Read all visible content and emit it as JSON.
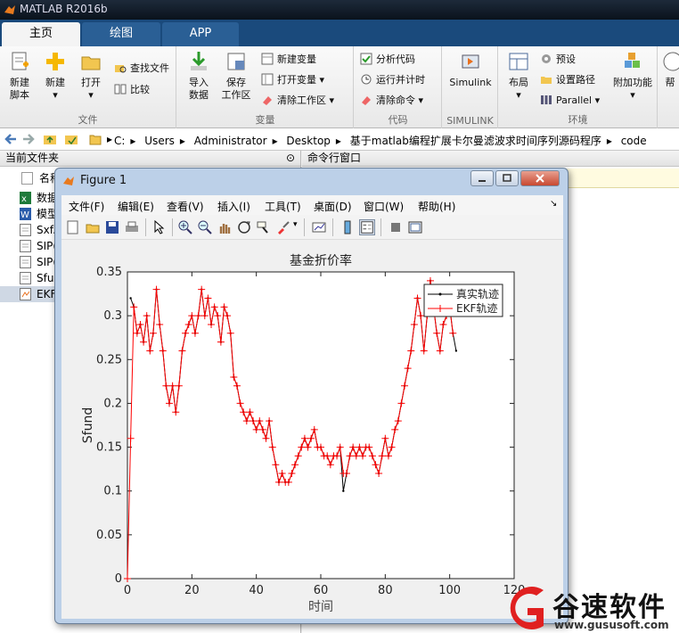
{
  "app": {
    "title": "MATLAB R2016b"
  },
  "tabs": [
    {
      "label": "主页",
      "active": true
    },
    {
      "label": "绘图",
      "active": false
    },
    {
      "label": "APP",
      "active": false
    }
  ],
  "ribbon": {
    "file": {
      "label": "文件",
      "new_script": "新建\n脚本",
      "new": "新建",
      "open": "打开",
      "find_files": "查找文件",
      "compare": "比较"
    },
    "variable": {
      "label": "变量",
      "import": "导入\n数据",
      "save_ws": "保存\n工作区",
      "new_var": "新建变量",
      "open_var": "打开变量",
      "clear_ws": "清除工作区"
    },
    "code": {
      "label": "代码",
      "analyze": "分析代码",
      "run_time": "运行并计时",
      "clear_cmd": "清除命令"
    },
    "simulink": {
      "label": "SIMULINK",
      "btn": "Simulink"
    },
    "env": {
      "label": "环境",
      "layout": "布局",
      "prefs": "预设",
      "set_path": "设置路径",
      "parallel": "Parallel",
      "addons": "附加功能",
      "help": "帮"
    }
  },
  "address": {
    "path": [
      "C:",
      "Users",
      "Administrator",
      "Desktop",
      "基于matlab编程扩展卡尔曼滤波求时间序列源码程序",
      "code"
    ]
  },
  "left_panel": {
    "title": "当前文件夹",
    "col_name": "名称",
    "files": [
      {
        "name": "数据",
        "type": "xls"
      },
      {
        "name": "模型",
        "type": "doc"
      },
      {
        "name": "Sxf.",
        "type": "m"
      },
      {
        "name": "SIP(",
        "type": "m"
      },
      {
        "name": "SIP(",
        "type": "m"
      },
      {
        "name": "Sfun",
        "type": "m"
      },
      {
        "name": "EKF",
        "type": "m",
        "selected": true
      }
    ]
  },
  "command_window": {
    "title": "命令行窗口"
  },
  "figure": {
    "title": "Figure 1",
    "menu": [
      "文件(F)",
      "编辑(E)",
      "查看(V)",
      "插入(I)",
      "工具(T)",
      "桌面(D)",
      "窗口(W)",
      "帮助(H)"
    ]
  },
  "chart_data": {
    "type": "line",
    "title": "基金折价率",
    "xlabel": "时间",
    "ylabel": "Sfund",
    "xlim": [
      0,
      120
    ],
    "ylim": [
      0,
      0.35
    ],
    "xticks": [
      "0",
      "20",
      "40",
      "60",
      "80",
      "100",
      "120"
    ],
    "yticks": [
      "0",
      "0.05",
      "0.1",
      "0.15",
      "0.2",
      "0.25",
      "0.3",
      "0.35"
    ],
    "legend_position": "top-right",
    "series": [
      {
        "name": "真实轨迹",
        "color": "#000000",
        "marker": "dot",
        "x": [
          1,
          2,
          3,
          4,
          5,
          6,
          7,
          8,
          9,
          10,
          11,
          12,
          13,
          14,
          15,
          16,
          17,
          18,
          19,
          20,
          21,
          22,
          23,
          24,
          25,
          26,
          27,
          28,
          29,
          30,
          31,
          32,
          33,
          34,
          35,
          36,
          37,
          38,
          39,
          40,
          41,
          42,
          43,
          44,
          45,
          46,
          47,
          48,
          49,
          50,
          51,
          52,
          53,
          54,
          55,
          56,
          57,
          58,
          59,
          60,
          61,
          62,
          63,
          64,
          65,
          66,
          67,
          68,
          69,
          70,
          71,
          72,
          73,
          74,
          75,
          76,
          77,
          78,
          79,
          80,
          81,
          82,
          83,
          84,
          85,
          86,
          87,
          88,
          89,
          90,
          91,
          92,
          93,
          94,
          95,
          96,
          97,
          98,
          99,
          100,
          101,
          102
        ],
        "y": [
          0.32,
          0.31,
          0.28,
          0.29,
          0.27,
          0.3,
          0.26,
          0.28,
          0.33,
          0.29,
          0.26,
          0.22,
          0.2,
          0.22,
          0.19,
          0.22,
          0.26,
          0.28,
          0.29,
          0.3,
          0.28,
          0.3,
          0.33,
          0.3,
          0.32,
          0.29,
          0.31,
          0.3,
          0.27,
          0.31,
          0.3,
          0.28,
          0.23,
          0.22,
          0.2,
          0.19,
          0.18,
          0.19,
          0.18,
          0.17,
          0.18,
          0.17,
          0.16,
          0.18,
          0.15,
          0.13,
          0.11,
          0.12,
          0.11,
          0.11,
          0.12,
          0.13,
          0.14,
          0.15,
          0.16,
          0.15,
          0.16,
          0.17,
          0.15,
          0.15,
          0.14,
          0.14,
          0.13,
          0.14,
          0.14,
          0.15,
          0.1,
          0.12,
          0.14,
          0.15,
          0.14,
          0.15,
          0.14,
          0.15,
          0.15,
          0.14,
          0.13,
          0.12,
          0.14,
          0.16,
          0.14,
          0.15,
          0.17,
          0.18,
          0.2,
          0.22,
          0.24,
          0.26,
          0.29,
          0.32,
          0.3,
          0.26,
          0.3,
          0.34,
          0.31,
          0.28,
          0.26,
          0.29,
          0.3,
          0.31,
          0.28,
          0.26
        ]
      },
      {
        "name": "EKF轨迹",
        "color": "#ff0000",
        "marker": "plus",
        "x": [
          0,
          1,
          2,
          3,
          4,
          5,
          6,
          7,
          8,
          9,
          10,
          11,
          12,
          13,
          14,
          15,
          16,
          17,
          18,
          19,
          20,
          21,
          22,
          23,
          24,
          25,
          26,
          27,
          28,
          29,
          30,
          31,
          32,
          33,
          34,
          35,
          36,
          37,
          38,
          39,
          40,
          41,
          42,
          43,
          44,
          45,
          46,
          47,
          48,
          49,
          50,
          51,
          52,
          53,
          54,
          55,
          56,
          57,
          58,
          59,
          60,
          61,
          62,
          63,
          64,
          65,
          66,
          67,
          68,
          69,
          70,
          71,
          72,
          73,
          74,
          75,
          76,
          77,
          78,
          79,
          80,
          81,
          82,
          83,
          84,
          85,
          86,
          87,
          88,
          89,
          90,
          91,
          92,
          93,
          94,
          95,
          96,
          97,
          98,
          99,
          100,
          101
        ],
        "y": [
          0.0,
          0.16,
          0.31,
          0.28,
          0.29,
          0.27,
          0.3,
          0.26,
          0.28,
          0.33,
          0.29,
          0.26,
          0.22,
          0.2,
          0.22,
          0.19,
          0.22,
          0.26,
          0.28,
          0.29,
          0.3,
          0.28,
          0.3,
          0.33,
          0.3,
          0.32,
          0.29,
          0.31,
          0.3,
          0.27,
          0.31,
          0.3,
          0.28,
          0.23,
          0.22,
          0.2,
          0.19,
          0.18,
          0.19,
          0.18,
          0.17,
          0.18,
          0.17,
          0.16,
          0.18,
          0.15,
          0.13,
          0.11,
          0.12,
          0.11,
          0.11,
          0.12,
          0.13,
          0.14,
          0.15,
          0.16,
          0.15,
          0.16,
          0.17,
          0.15,
          0.15,
          0.14,
          0.14,
          0.13,
          0.14,
          0.14,
          0.15,
          0.12,
          0.12,
          0.14,
          0.15,
          0.14,
          0.15,
          0.14,
          0.15,
          0.15,
          0.14,
          0.13,
          0.12,
          0.14,
          0.16,
          0.14,
          0.15,
          0.17,
          0.18,
          0.2,
          0.22,
          0.24,
          0.26,
          0.29,
          0.32,
          0.3,
          0.26,
          0.3,
          0.34,
          0.31,
          0.28,
          0.26,
          0.29,
          0.3,
          0.31,
          0.28
        ]
      }
    ]
  },
  "watermark": {
    "text": "谷速软件",
    "url": "www.gususoft.com",
    "color": "#e02020"
  }
}
